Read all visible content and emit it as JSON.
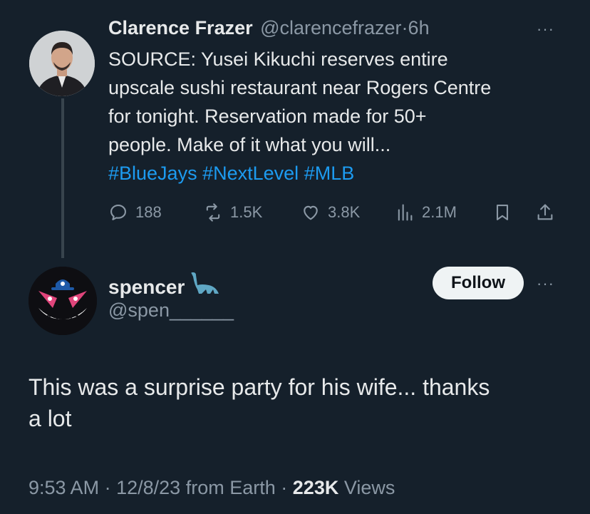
{
  "original_tweet": {
    "author_name": "Clarence Frazer",
    "handle": "@clarencefrazer",
    "separator": "·",
    "time": "6h",
    "more_label": "···",
    "lines": [
      "SOURCE: Yusei Kikuchi reserves entire",
      "upscale sushi restaurant near Rogers Centre",
      "for tonight. Reservation made for 50+",
      "people. Make of it what you will..."
    ],
    "hashtags": [
      "#BlueJays",
      "#NextLevel",
      "#MLB"
    ],
    "actions": {
      "replies": "188",
      "retweets": "1.5K",
      "likes": "3.8K",
      "views": "2.1M"
    }
  },
  "reply_tweet": {
    "author_name": "spencer",
    "author_emoji_icon": "brachiosaurus-icon",
    "handle": "@spen______",
    "follow_label": "Follow",
    "more_label": "···",
    "lines": [
      "This was a surprise party for his wife... thanks",
      "a lot"
    ],
    "meta": {
      "time": "9:53 AM",
      "date": "12/8/23",
      "source": "from Earth",
      "sep": "·",
      "views_count": "223K",
      "views_label": "Views"
    }
  },
  "colors": {
    "background": "#15202b",
    "text": "#e7e9ea",
    "muted": "#8b98a5",
    "link": "#1d9bf0"
  }
}
